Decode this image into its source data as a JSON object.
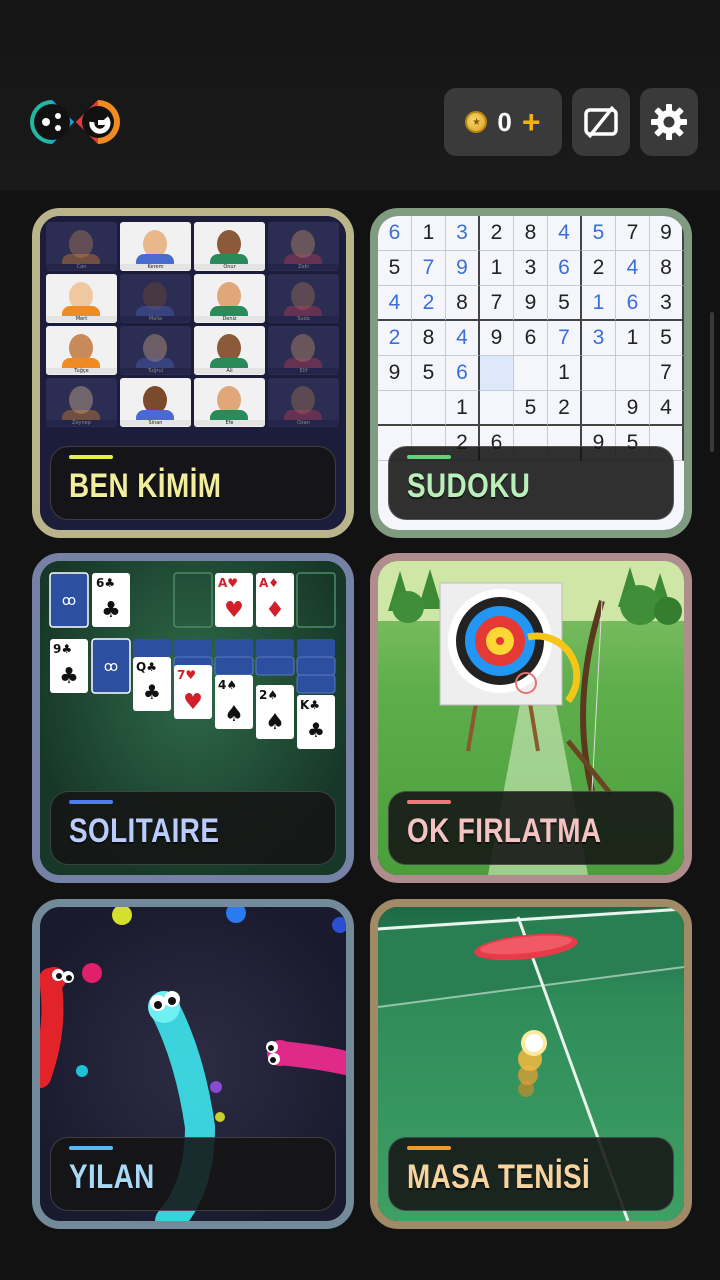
{
  "header": {
    "coin_count": "0",
    "add_coins_symbol": "+",
    "icons": [
      "app-logo-icon",
      "coin-icon",
      "no-ads-icon",
      "gear-icon"
    ]
  },
  "games": [
    {
      "title": "BEN KİMİM",
      "accent": "#e8ef4a",
      "border": "#b9b48a",
      "title_color": "#f2ef9c"
    },
    {
      "title": "SUDOKU",
      "accent": "#5ed37a",
      "border": "#7f9c80",
      "title_color": "#b9efb8"
    },
    {
      "title": "SOLITAIRE",
      "accent": "#4f7cf2",
      "border": "#7582a6",
      "title_color": "#b9ccfb"
    },
    {
      "title": "OK FIRLATMA",
      "accent": "#f07878",
      "border": "#b08d8d",
      "title_color": "#f6c3c3"
    },
    {
      "title": "YILAN",
      "accent": "#58b9f0",
      "border": "#728a9a",
      "title_color": "#a9d9f7"
    },
    {
      "title": "MASA TENİSİ",
      "accent": "#f09b2a",
      "border": "#a08b66",
      "title_color": "#f7d49f"
    }
  ],
  "ben_kimim": {
    "names": [
      "Can",
      "Kerem",
      "Onur",
      "Zeki",
      "Mert",
      "Mella",
      "Deniz",
      "Sude",
      "Tuğçe",
      "Tuğrul",
      "Ali",
      "Elif",
      "Zeynep",
      "Sinan",
      "Efe",
      "Ozan"
    ]
  },
  "sudoku": {
    "rows": [
      [
        "6",
        "1",
        "3",
        "2",
        "8",
        "4",
        "5",
        "7",
        "9"
      ],
      [
        "5",
        "7",
        "9",
        "1",
        "3",
        "6",
        "2",
        "4",
        "8"
      ],
      [
        "4",
        "2",
        "8",
        "7",
        "9",
        "5",
        "1",
        "6",
        "3"
      ],
      [
        "2",
        "8",
        "4",
        "9",
        "6",
        "7",
        "3",
        "1",
        "5"
      ],
      [
        "9",
        "5",
        "6",
        "",
        "",
        "1",
        "",
        "",
        "7"
      ],
      [
        "",
        "",
        "1",
        "",
        "5",
        "2",
        "",
        "9",
        "4"
      ],
      [
        "",
        "",
        "2",
        "6",
        "",
        "",
        "9",
        "5",
        ""
      ]
    ]
  },
  "solitaire": {
    "cards": [
      "6♣",
      "A♥",
      "A♦",
      "9♣",
      "Q♣",
      "7♥",
      "4♠",
      "2♠",
      "K♣"
    ]
  }
}
